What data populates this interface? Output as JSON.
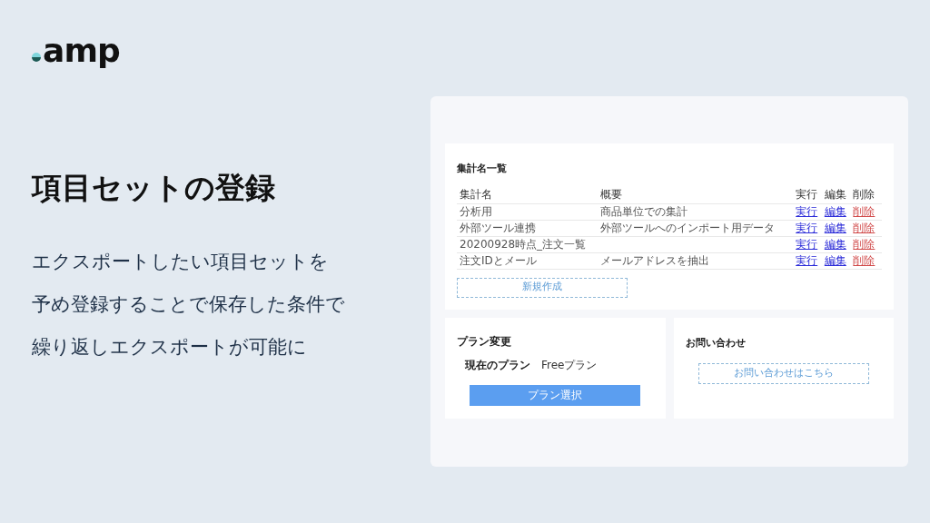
{
  "logo": {
    "text": "amp"
  },
  "headline": "項目セットの登録",
  "description": [
    "エクスポートしたい項目セットを",
    "予め登録することで保存した条件で",
    "繰り返しエクスポートが可能に"
  ],
  "list_panel": {
    "title": "集計名一覧",
    "columns": [
      "集計名",
      "概要",
      "実行",
      "編集",
      "削除"
    ],
    "rows": [
      {
        "name": "分析用",
        "summary": "商品単位での集計",
        "run": "実行",
        "edit": "編集",
        "delete": "削除"
      },
      {
        "name": "外部ツール連携",
        "summary": "外部ツールへのインポート用データ",
        "run": "実行",
        "edit": "編集",
        "delete": "削除"
      },
      {
        "name": "20200928時点_注文一覧",
        "run": "実行",
        "edit": "編集",
        "delete": "削除"
      },
      {
        "name": "注文IDとメール",
        "summary": "メールアドレスを抽出",
        "run": "実行",
        "edit": "編集",
        "delete": "削除"
      }
    ],
    "new_button": "新規作成"
  },
  "plan_panel": {
    "title": "プラン変更",
    "current_label": "現在のプラン",
    "current_value": "Freeプラン",
    "button": "プラン選択"
  },
  "contact_panel": {
    "title": "お問い合わせ",
    "button": "お問い合わせはこちら"
  }
}
